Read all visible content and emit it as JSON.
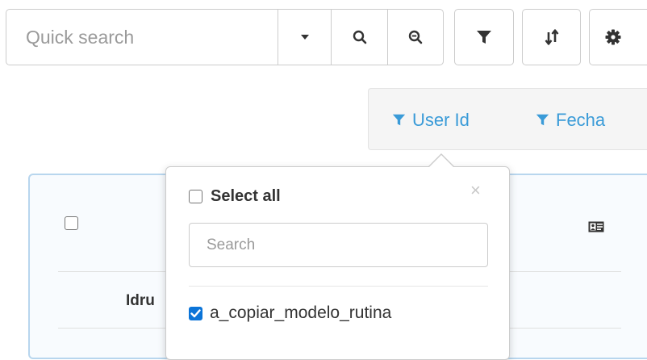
{
  "toolbar": {
    "search": {
      "placeholder": "Quick search",
      "value": ""
    },
    "buttons": {
      "dropdown_icon": "caret-down-icon",
      "search_icon": "search-icon",
      "clear_search_icon": "zoom-out-icon",
      "filter_icon": "filter-icon",
      "sort_icon": "sort-icon",
      "settings_icon": "gear-icon"
    }
  },
  "filter_chips": [
    {
      "label": "User Id",
      "icon": "filter-icon"
    },
    {
      "label": "Fecha",
      "icon": "filter-icon"
    }
  ],
  "filter_popover": {
    "close_label": "×",
    "select_all": {
      "label": "Select all",
      "checked": false
    },
    "search": {
      "placeholder": "Search",
      "value": ""
    },
    "items": [
      {
        "label": "a_copiar_modelo_rutina",
        "checked": true
      }
    ]
  },
  "grid": {
    "header_checkbox_checked": false,
    "column_header": "Idru",
    "column_chooser_icon": "id-card-icon"
  },
  "colors": {
    "accent": "#3a9bd8",
    "checkbox_checked": "#0b74d8",
    "grid_border": "#b8d6ee",
    "icon_dark": "#333333"
  }
}
